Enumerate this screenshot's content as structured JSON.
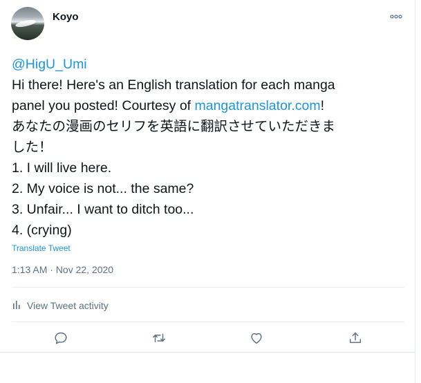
{
  "tweet": {
    "author": "Koyo",
    "mention": "@HigU_Umi",
    "line1": "Hi there! Here's an English translation for each manga",
    "line2_prefix": "panel you posted! Courtesy of ",
    "line2_link": "mangatranslator.com",
    "line2_suffix": "!",
    "line3": "あなたの漫画のセリフを英語に翻訳させていただきま",
    "line4": "した！",
    "items": [
      "1. I will live here.",
      "2. My voice is not... the same?",
      "3. Unfair... I want to ditch too...",
      "4. (crying)"
    ],
    "translate_label": "Translate Tweet",
    "timestamp": "1:13 AM · Nov 22, 2020",
    "activity_label": "View Tweet activity"
  },
  "icons": {
    "more": "more-horizontal-icon",
    "activity": "bar-chart-icon",
    "reply": "reply-icon",
    "retweet": "retweet-icon",
    "like": "heart-icon",
    "share": "share-icon"
  },
  "colors": {
    "link": "#1b95e0",
    "secondary": "#5b7083",
    "text": "#0f1419",
    "divider": "#e6ecf0"
  }
}
